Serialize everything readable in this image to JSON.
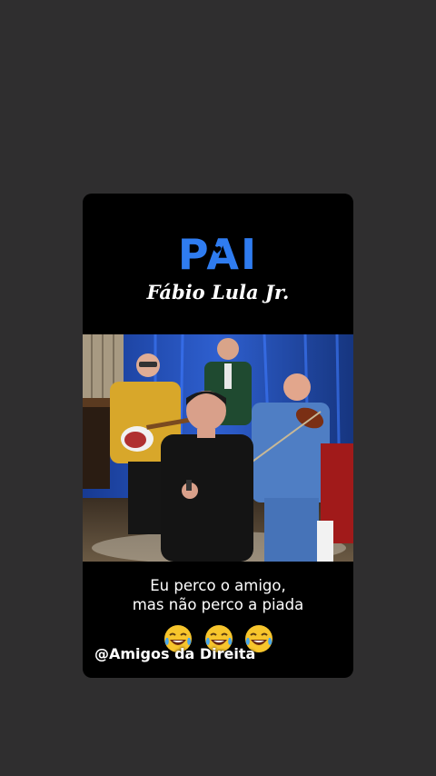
{
  "post": {
    "title": "PAI",
    "subtitle": "Fábio Lula Jr.",
    "caption_line1": "Eu perco o amigo,",
    "caption_line2": "mas não perco a piada",
    "watermark": "@Amigos da Direita",
    "emoji_icon": "tears-of-joy-emoji",
    "emoji_count": 3
  },
  "colors": {
    "background": "#2f2e2f",
    "card": "#000000",
    "title_blue": "#2f7cf0",
    "stage_blue": "#1b3a7d"
  }
}
